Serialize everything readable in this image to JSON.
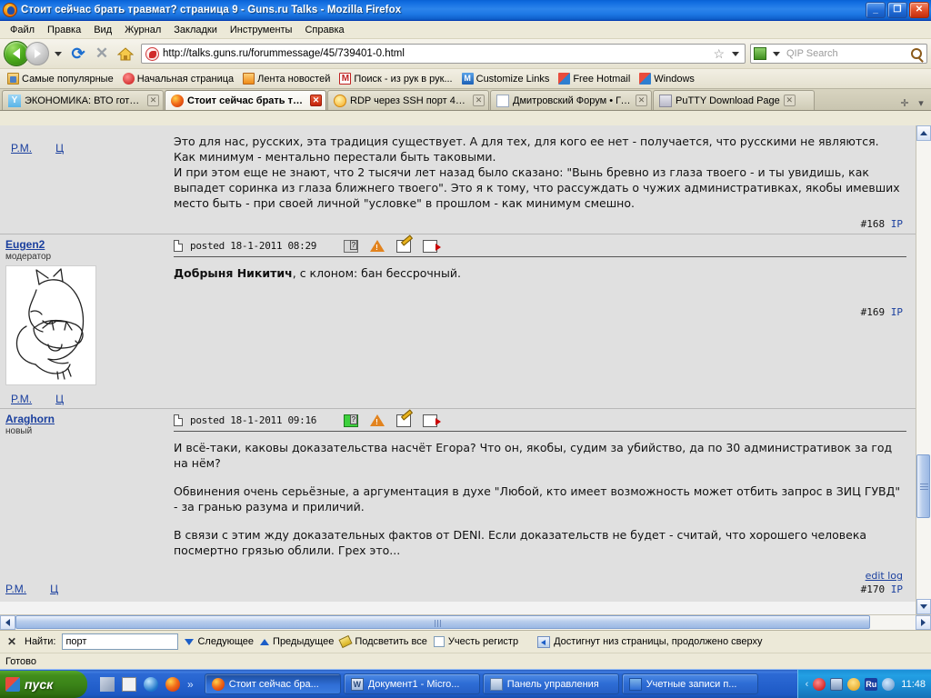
{
  "window": {
    "title": "Стоит сейчас брать травмат? страница 9 - Guns.ru Talks - Mozilla Firefox",
    "minimize": "_",
    "maximize": "❐",
    "close": "✕"
  },
  "menubar": [
    {
      "label": "Файл"
    },
    {
      "label": "Правка"
    },
    {
      "label": "Вид"
    },
    {
      "label": "Журнал"
    },
    {
      "label": "Закладки"
    },
    {
      "label": "Инструменты"
    },
    {
      "label": "Справка"
    }
  ],
  "toolbar": {
    "url": "http://talks.guns.ru/forummessage/45/739401-0.html",
    "search_placeholder": "QIP Search",
    "star": "☆"
  },
  "bookmarks": [
    {
      "label": "Самые популярные",
      "icon": "folder-icon"
    },
    {
      "label": "Начальная страница",
      "icon": "red-dot-icon"
    },
    {
      "label": "Лента новостей",
      "icon": "rss-icon"
    },
    {
      "label": "Поиск - из рук в рук...",
      "icon": "mm-icon"
    },
    {
      "label": "Customize Links",
      "icon": "m-blue-icon"
    },
    {
      "label": "Free Hotmail",
      "icon": "windows-flag-icon"
    },
    {
      "label": "Windows",
      "icon": "windows-flag-icon"
    }
  ],
  "tabs": [
    {
      "label": "ЭКОНОМИКА: ВТО готова...",
      "icon": "yandex-icon",
      "active": false
    },
    {
      "label": "Стоит сейчас брать тр...",
      "icon": "firefox-icon",
      "active": true
    },
    {
      "label": "RDP через SSH порт 443 »...",
      "icon": "sun-icon",
      "active": false
    },
    {
      "label": "Дмитровский Форум • Гла...",
      "icon": "document-icon",
      "active": false
    },
    {
      "label": "PuTTY Download Page",
      "icon": "putty-icon",
      "active": false
    }
  ],
  "tab_controls": {
    "new_tab": "✛",
    "list": "▾"
  },
  "posts": [
    {
      "author": "",
      "rank": "",
      "pm_label": "P.M.",
      "quote_label": "Ц",
      "paragraphs": [
        "Это для нас, русских, эта традиция существует. А для тех, для кого ее нет - получается, что русскими не являются. Как минимум - ментально перестали быть таковыми.",
        "И при этом еще не знают, что 2 тысячи лет назад было сказано: \"Вынь бревно из глаза твоего - и ты увидишь, как выпадет соринка из глаза ближнего твоего\". Это я к тому, что рассуждать о чужих административках, якобы имевших место быть - при своей личной \"условке\" в прошлом - как минимум смешно."
      ],
      "post_number": "#168",
      "ip_label": "IP"
    },
    {
      "author": "Eugen2",
      "rank": "модератор",
      "posted": "posted 18-1-2011 08:29",
      "body_bold": "Добрыня Никитич",
      "body_rest": ", с клоном: бан бессрочный.",
      "post_number": "#169",
      "ip_label": "IP",
      "pm_label": "P.M.",
      "quote_label": "Ц"
    },
    {
      "author": "Araghorn",
      "rank": "новый",
      "posted": "posted 18-1-2011 09:16",
      "paragraphs": [
        "И всё-таки, каковы доказательства насчёт Егора? Что он, якобы, судим за убийство, да по 30 административок за год на нём?",
        "Обвинения очень серьёзные, а аргументация в духе \"Любой, кто имеет возможность может отбить запрос в ЗИЦ ГУВД\" - за гранью разума и приличий.",
        "В связи с этим жду доказательных фактов от DENI. Если доказательств не будет - считай, что хорошего человека посмертно грязью облили. Грех это..."
      ],
      "edit_log": "edit log",
      "post_number": "#170",
      "ip_label": "IP",
      "pm_label": "P.M.",
      "quote_label": "Ц"
    }
  ],
  "post_icons": {
    "doc": "document-icon",
    "card": "profile-card-icon",
    "warn": "report-icon",
    "edit": "edit-icon",
    "quote": "quote-icon"
  },
  "findbar": {
    "close": "✕",
    "label": "Найти:",
    "value": "порт",
    "next": "Следующее",
    "prev": "Предыдущее",
    "highlight": "Подсветить все",
    "match_case": "Учесть регистр",
    "status": "Достигнут низ страницы, продолжено сверху"
  },
  "statusbar": {
    "text": "Готово"
  },
  "taskbar": {
    "start": "пуск",
    "quicklaunch": [
      {
        "icon": "show-desktop-icon"
      },
      {
        "icon": "calculator-icon"
      },
      {
        "icon": "internet-explorer-icon"
      },
      {
        "icon": "firefox-icon"
      }
    ],
    "quicklaunch_more": "»",
    "tasks": [
      {
        "label": "Стоит сейчас бра...",
        "icon": "firefox-icon",
        "active": true
      },
      {
        "label": "Документ1 - Micro...",
        "icon": "word-icon",
        "active": false
      },
      {
        "label": "Панель управления",
        "icon": "control-panel-icon",
        "active": false
      },
      {
        "label": "Учетные записи п...",
        "icon": "user-accounts-icon",
        "active": false
      }
    ],
    "tray": {
      "expand": "‹",
      "icons": [
        "opera-icon",
        "network-icon",
        "shield-icon",
        "misc-icon"
      ],
      "language": "Ru",
      "clock": "11:48"
    }
  }
}
